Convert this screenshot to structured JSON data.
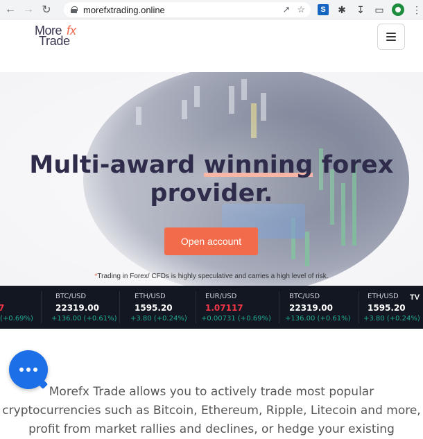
{
  "browser": {
    "url": "morefxtrading.online"
  },
  "site": {
    "logo": {
      "more": "More",
      "fx": "fx",
      "trade": "Trade"
    }
  },
  "hero": {
    "title_line1_a": "Multi-award ",
    "title_line1_hl": "winning",
    "title_line1_b": " forex",
    "title_line2": "provider.",
    "cta_label": "Open account",
    "risk_star": "*",
    "risk_text": "Trading in Forex/ CFDs is highly speculative and carries a high level of risk."
  },
  "ticker": {
    "items": [
      {
        "symbol": "",
        "price": "7",
        "change": "(+0.69%)",
        "price_color": "red"
      },
      {
        "symbol": "BTC/USD",
        "price": "22319.00",
        "change": "+136.00 (+0.61%)",
        "price_color": "white"
      },
      {
        "symbol": "ETH/USD",
        "price": "1595.20",
        "change": "+3.80 (+0.24%)",
        "price_color": "white"
      },
      {
        "symbol": "EUR/USD",
        "price": "1.07117",
        "change": "+0.00731 (+0.69%)",
        "price_color": "red"
      },
      {
        "symbol": "BTC/USD",
        "price": "22319.00",
        "change": "+136.00 (+0.61%)",
        "price_color": "white"
      },
      {
        "symbol": "ETH/USD",
        "price": "1595.20",
        "change": "+3.80 (+0.24%)",
        "price_color": "white"
      }
    ],
    "brand": "TV"
  },
  "body": {
    "line1": "Morefx Trade allows you to actively trade most popular",
    "line2": "cryptocurrencies such as Bitcoin, Ethereum, Ripple, Litecoin and more,",
    "line3": "profit from market rallies and declines, or hedge your existing"
  },
  "colors": {
    "accent": "#f26b4b",
    "navy": "#2f2b4a",
    "ticker_bg": "#131722",
    "up": "#22ab94",
    "down": "#f23645",
    "chat": "#1c6fe6"
  }
}
